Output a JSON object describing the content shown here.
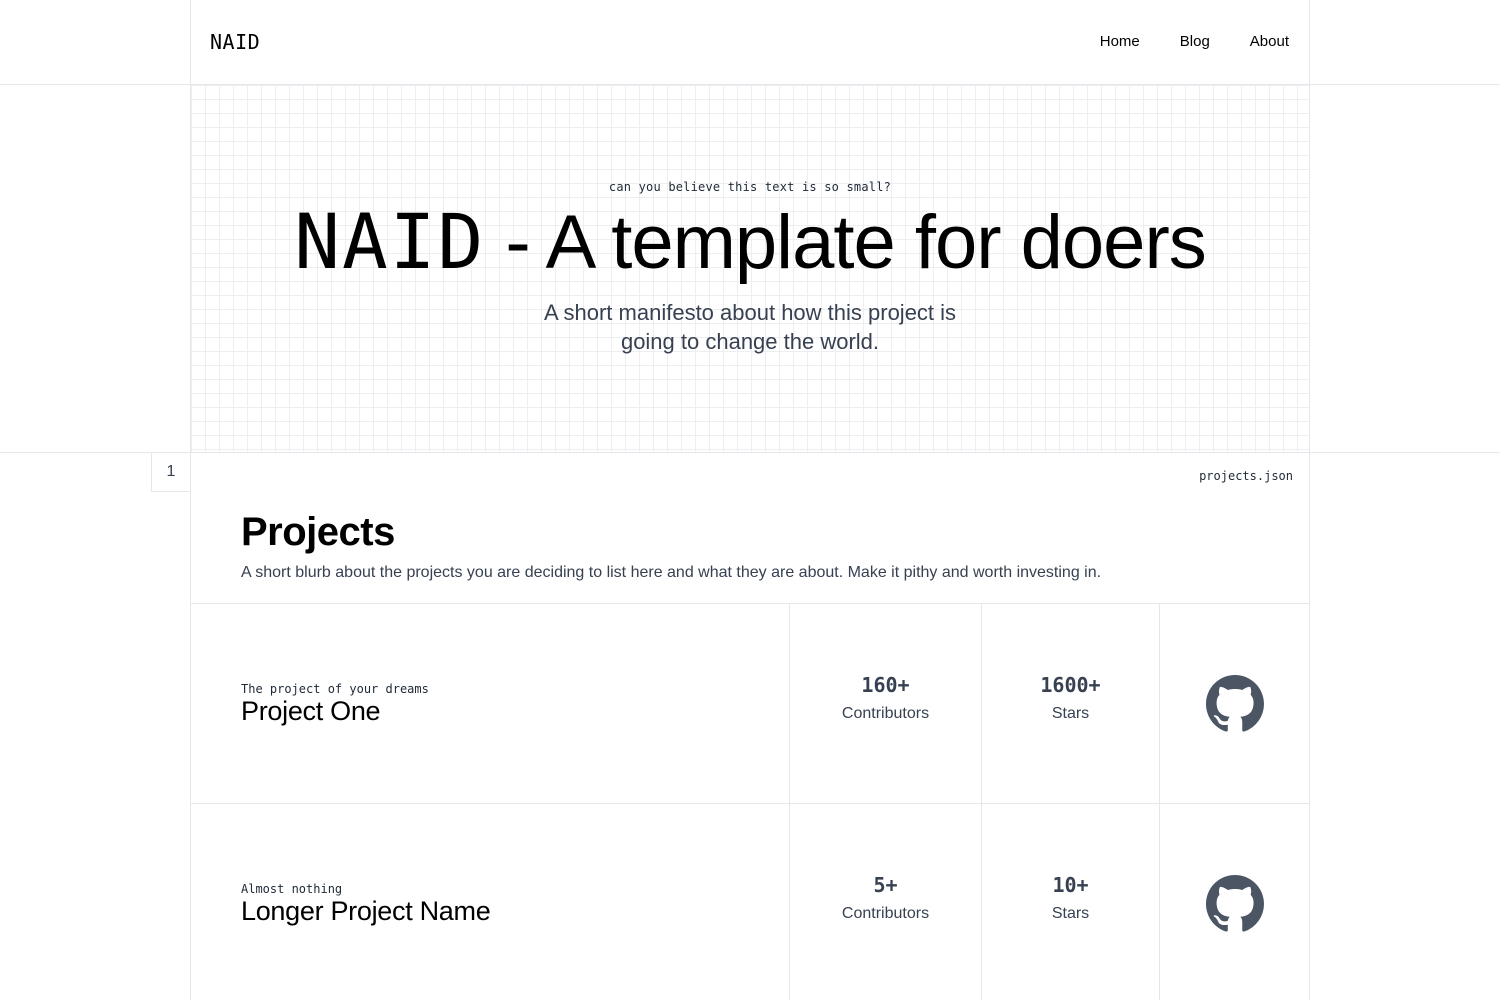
{
  "header": {
    "logo": "NAID",
    "nav": [
      {
        "label": "Home"
      },
      {
        "label": "Blog"
      },
      {
        "label": "About"
      }
    ]
  },
  "hero": {
    "kicker": "can you believe this text is so small?",
    "title_mono": "NAID",
    "title_rest": " - A template for doers",
    "subtitle": "A short manifesto about how this project is going to change the world."
  },
  "section": {
    "number": "1",
    "file": "projects.json",
    "heading": "Projects",
    "blurb": "A short blurb about the projects you are deciding to list here and what they are about. Make it pithy and worth investing in."
  },
  "projects": [
    {
      "tagline": "The project of your dreams",
      "name": "Project One",
      "contributors": "160+",
      "contributors_label": "Contributors",
      "stars": "1600+",
      "stars_label": "Stars",
      "icon": "github-icon"
    },
    {
      "tagline": "Almost nothing",
      "name": "Longer Project Name",
      "contributors": "5+",
      "contributors_label": "Contributors",
      "stars": "10+",
      "stars_label": "Stars",
      "icon": "github-icon"
    }
  ],
  "colors": {
    "text": "#000000",
    "muted": "#374151",
    "border": "#e5e7eb",
    "grid": "#eceef1"
  }
}
